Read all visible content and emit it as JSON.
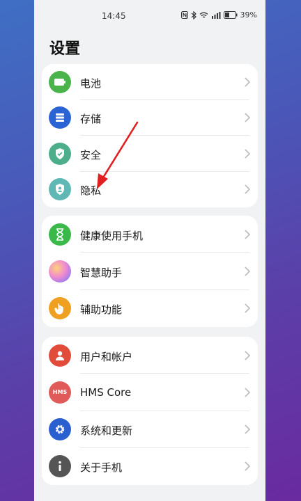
{
  "status": {
    "time": "14:45",
    "battery": "39%",
    "icons": [
      "nfc-icon",
      "bluetooth-icon",
      "wifi-icon",
      "signal-icon",
      "battery-icon"
    ]
  },
  "page": {
    "title": "设置"
  },
  "groups": [
    {
      "items": [
        {
          "label": "电池",
          "icon": "battery-icon",
          "color": "#4bb34b"
        },
        {
          "label": "存储",
          "icon": "storage-icon",
          "color": "#2a63d4"
        },
        {
          "label": "安全",
          "icon": "shield-icon",
          "color": "#4dae8b"
        },
        {
          "label": "隐私",
          "icon": "privacy-icon",
          "color": "#5fb8b4"
        }
      ]
    },
    {
      "items": [
        {
          "label": "健康使用手机",
          "icon": "hourglass-icon",
          "color": "#3bb84a"
        },
        {
          "label": "智慧助手",
          "icon": "assistant-icon",
          "color": "#d68ad6"
        },
        {
          "label": "辅助功能",
          "icon": "hand-icon",
          "color": "#f0a020"
        }
      ]
    },
    {
      "items": [
        {
          "label": "用户和帐户",
          "icon": "user-icon",
          "color": "#e04b3a"
        },
        {
          "label": "HMS Core",
          "icon": "hms-icon",
          "color": "#e05a5a",
          "badge": "HMS"
        },
        {
          "label": "系统和更新",
          "icon": "gear-icon",
          "color": "#2a5fd0"
        },
        {
          "label": "关于手机",
          "icon": "info-icon",
          "color": "#555555"
        }
      ]
    }
  ],
  "annotation_color": "#e02020"
}
